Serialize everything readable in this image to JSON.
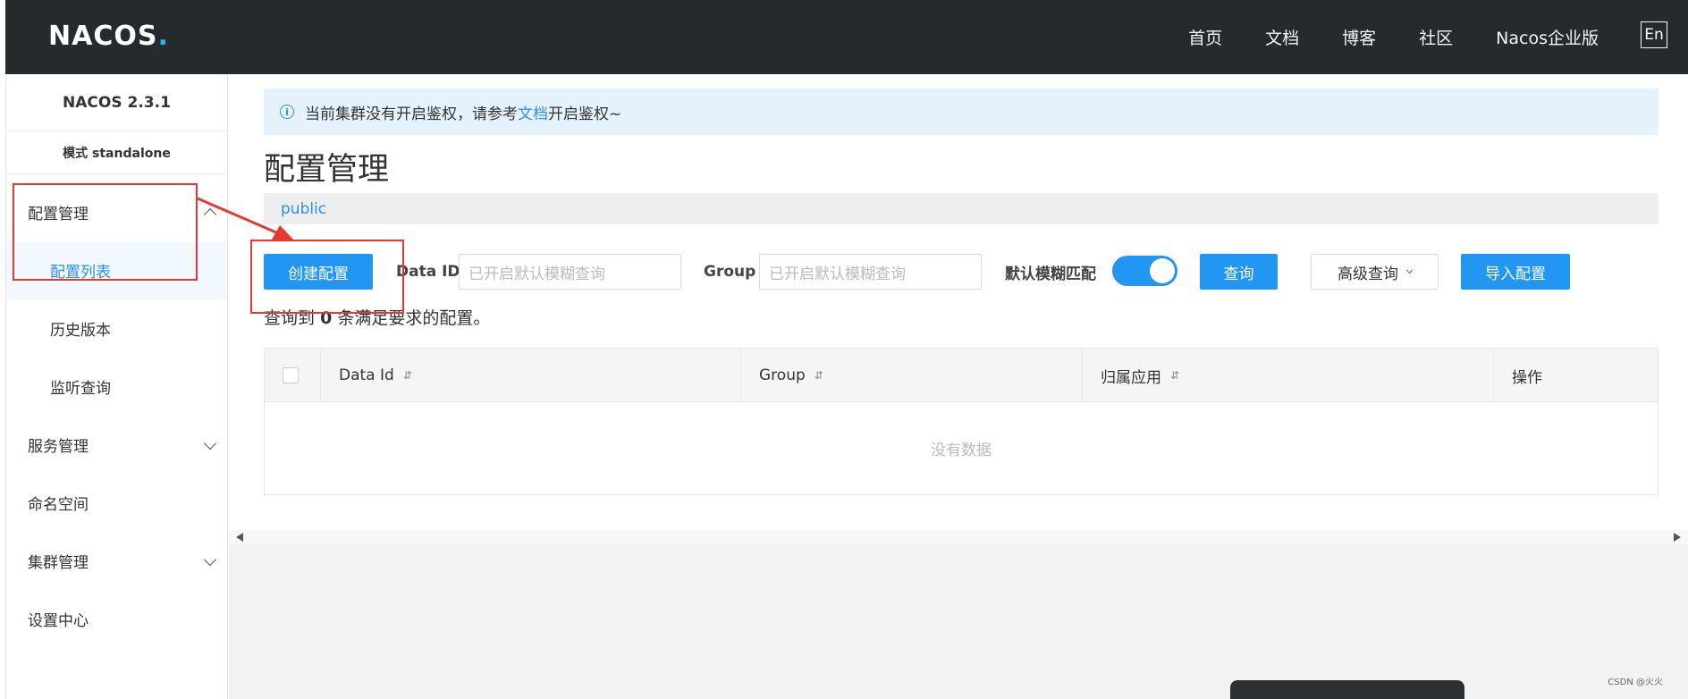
{
  "header": {
    "logo_text": "NACOS",
    "logo_dot": ".",
    "nav": [
      "首页",
      "文档",
      "博客",
      "社区",
      "Nacos企业版"
    ],
    "lang_button": "En"
  },
  "sidebar": {
    "version": "NACOS 2.3.1",
    "mode": "模式 standalone",
    "items": [
      {
        "label": "配置管理"
      },
      {
        "label": "配置列表"
      },
      {
        "label": "历史版本"
      },
      {
        "label": "监听查询"
      },
      {
        "label": "服务管理"
      },
      {
        "label": "命名空间"
      },
      {
        "label": "集群管理"
      },
      {
        "label": "设置中心"
      }
    ]
  },
  "notice": {
    "prefix": "当前集群没有开启鉴权，请参考",
    "link": "文档",
    "suffix": "开启鉴权~"
  },
  "page": {
    "title": "配置管理",
    "namespace": "public"
  },
  "toolbar": {
    "create_label": "创建配置",
    "dataid_label": "Data ID",
    "dataid_placeholder": "已开启默认模糊查询",
    "group_label": "Group",
    "group_placeholder": "已开启默认模糊查询",
    "fuzzy_label": "默认模糊匹配",
    "fuzzy_enabled": true,
    "query_label": "查询",
    "advanced_label": "高级查询",
    "import_label": "导入配置"
  },
  "result": {
    "prefix": "查询到",
    "count": "0",
    "suffix": "条满足要求的配置。"
  },
  "table": {
    "columns": [
      "Data Id",
      "Group",
      "归属应用",
      "操作"
    ],
    "empty_text": "没有数据"
  },
  "watermark": "CSDN @火火",
  "colors": {
    "primary": "#2196f3",
    "header_bg": "#252a2f",
    "annotation_red": "#e53935"
  }
}
